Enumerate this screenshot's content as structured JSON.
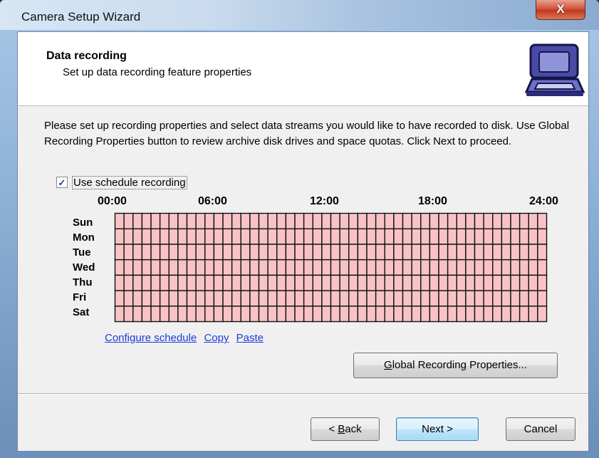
{
  "window": {
    "title": "Camera Setup Wizard",
    "close_glyph": "X"
  },
  "header": {
    "title": "Data recording",
    "subtitle": "Set up data recording feature properties",
    "icon": "briefcase-icon"
  },
  "intro_text": "Please set up recording properties and select data streams you would like to have recorded to disk. Use Global Recording Properties button to review archive disk drives and space quotas. Click Next to proceed.",
  "schedule_checkbox": {
    "label": "Use schedule recording",
    "checked": true
  },
  "schedule": {
    "hours": [
      "00:00",
      "06:00",
      "12:00",
      "18:00",
      "24:00"
    ],
    "days": [
      "Sun",
      "Mon",
      "Tue",
      "Wed",
      "Thu",
      "Fri",
      "Sat"
    ],
    "slots_per_day": 48,
    "fill_color": "#f9c3c6",
    "line_color": "#111111"
  },
  "links": {
    "configure": "Configure schedule",
    "copy": "Copy",
    "paste": "Paste"
  },
  "buttons": {
    "global_accel": "G",
    "global_rest": "lobal Recording Properties...",
    "back_prefix": "< ",
    "back_accel": "B",
    "back_rest": "ack",
    "next": "Next >",
    "cancel": "Cancel"
  }
}
